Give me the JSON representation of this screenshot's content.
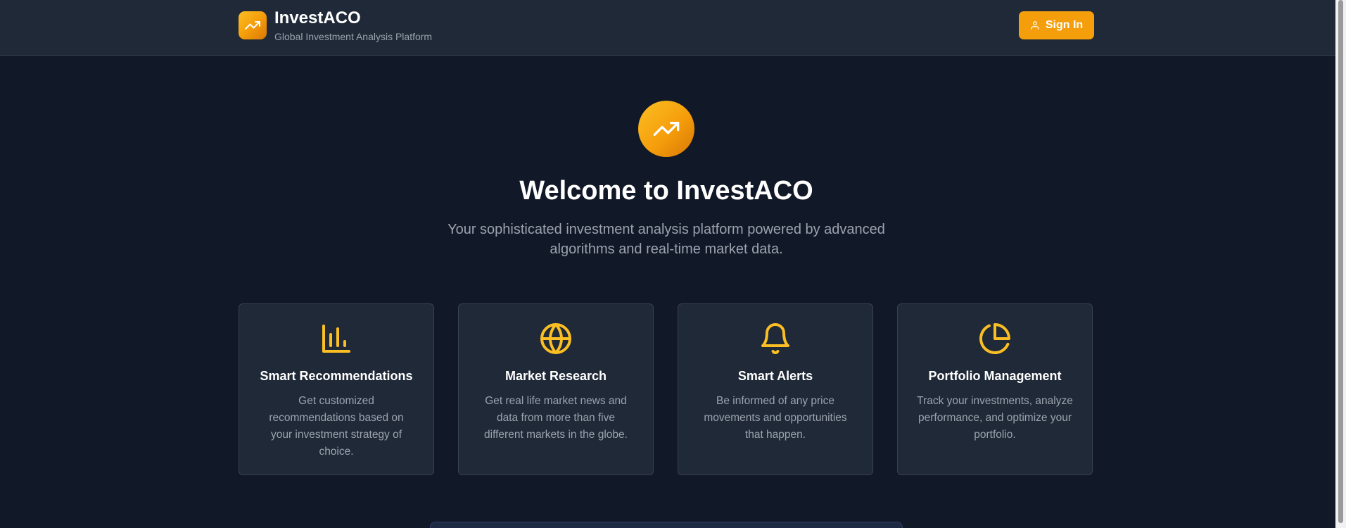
{
  "header": {
    "logo_icon": "trending-up-icon",
    "brand_name": "InvestACO",
    "tagline": "Global Investment Analysis Platform",
    "signin_icon": "user-icon",
    "signin_label": "Sign In"
  },
  "hero": {
    "icon": "trending-up-icon",
    "title": "Welcome to InvestACO",
    "subtitle": "Your sophisticated investment analysis platform powered by advanced algorithms and real-time market data."
  },
  "features": [
    {
      "icon": "bar-chart-icon",
      "title": "Smart Recommendations",
      "description": "Get customized recommendations based on your investment strategy of choice."
    },
    {
      "icon": "globe-icon",
      "title": "Market Research",
      "description": "Get real life market news and data from more than five different markets in the globe."
    },
    {
      "icon": "bell-icon",
      "title": "Smart Alerts",
      "description": "Be informed of any price movements and opportunities that happen."
    },
    {
      "icon": "pie-chart-icon",
      "title": "Portfolio Management",
      "description": "Track your investments, analyze performance, and optimize your portfolio."
    }
  ],
  "colors": {
    "accent": "#f59e0b",
    "icon_accent": "#fbbf24",
    "background": "#111827",
    "surface": "#1f2937",
    "border": "#374151",
    "muted_text": "#9ca3af"
  }
}
